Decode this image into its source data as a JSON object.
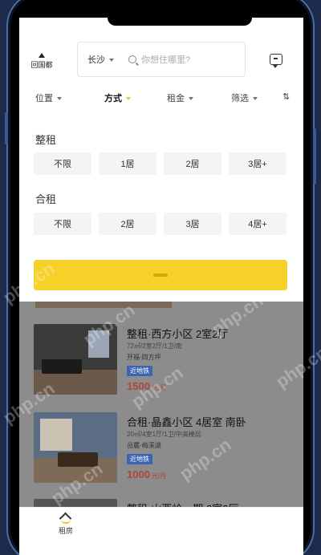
{
  "header": {
    "home_label": "回国都",
    "city": "长沙",
    "search_placeholder": "你想住哪里?"
  },
  "filter_tabs": [
    {
      "label": "位置",
      "active": false
    },
    {
      "label": "方式",
      "active": true
    },
    {
      "label": "租金",
      "active": false
    },
    {
      "label": "筛选",
      "active": false
    },
    {
      "label": "排序",
      "active": false
    }
  ],
  "panel": {
    "whole_rent": {
      "title": "整租",
      "options": [
        "不限",
        "1居",
        "2居",
        "3居+"
      ]
    },
    "shared_rent": {
      "title": "合租",
      "options": [
        "不限",
        "2居",
        "3居",
        "4居+"
      ]
    },
    "confirm_label": "确定"
  },
  "listings": [
    {
      "title": "整租·西方小区 2室2厅",
      "sub": "72㎡/2室2厅/1卫/南",
      "addr": "开福·四方坪",
      "tag": "近地铁",
      "price": "1500",
      "unit": "元/月"
    },
    {
      "title": "合租·晶鑫小区 4居室 南卧",
      "sub": "20㎡/4室1厅/1卫/中高楼层",
      "addr": "岳麓·梅溪湖",
      "tag": "近地铁",
      "price": "1000",
      "unit": "元/月"
    },
    {
      "title": "整租·山西岭一期 2室2厅",
      "sub": "",
      "addr": "",
      "tag": "",
      "price": "",
      "unit": ""
    }
  ],
  "tabbar": {
    "rent_label": "租房"
  },
  "watermark": "php.cn",
  "colors": {
    "accent_yellow": "#f6d12a",
    "price_red": "#b0443a",
    "tag_blue": "#3c64b0"
  }
}
